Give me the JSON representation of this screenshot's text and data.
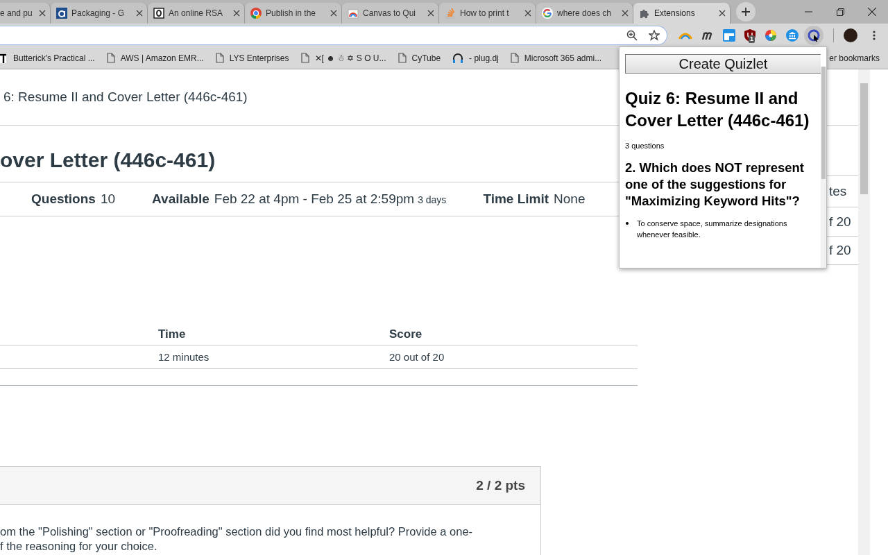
{
  "tabs": [
    {
      "title": "e and pu",
      "selected": false
    },
    {
      "title": "Packaging - G",
      "selected": false
    },
    {
      "title": "An online RSA",
      "selected": false
    },
    {
      "title": "Publish in the",
      "selected": false
    },
    {
      "title": "Canvas to Qui",
      "selected": false
    },
    {
      "title": "How to print t",
      "selected": false
    },
    {
      "title": "where does ch",
      "selected": false
    },
    {
      "title": "Extensions",
      "selected": true
    }
  ],
  "toolbar": {
    "extension_badge": "1"
  },
  "bookmarks": [
    "Butterick's Practical ...",
    "AWS | Amazon EMR...",
    "LYS Enterprises",
    "✕[ ☻ ☃ ✡ S O U...",
    "CyTube",
    "- plug.dj",
    "Microsoft 365 admi..."
  ],
  "other_bookmarks": "er bookmarks",
  "page": {
    "breadcrumb": "6: Resume II and Cover Letter (446c-461)",
    "title": "over Letter (446c-461)",
    "details": [
      {
        "label": "Questions",
        "value": "10"
      },
      {
        "label": "Available",
        "value": "Feb 22 at 4pm - Feb 25 at 2:59pm",
        "note": "3 days"
      },
      {
        "label": "Time Limit",
        "value": "None"
      }
    ],
    "sidebar": [
      "tes",
      "f 20",
      "f 20"
    ],
    "table": {
      "columns": [
        "Time",
        "Score"
      ],
      "rows": [
        [
          "12 minutes",
          "20 out of 20"
        ]
      ]
    },
    "question": {
      "points": "2 / 2 pts",
      "lines": [
        "om the \"Polishing\" section or \"Proofreading\" section did you find most helpful?  Provide a one-",
        "f the reasoning for your choice."
      ]
    }
  },
  "popup": {
    "button": "Create Quizlet",
    "title": "Quiz 6: Resume II and Cover Letter (446c-461)",
    "count": "3 questions",
    "questions": [
      {
        "text": "2. Which does NOT represent one of the suggestions for \"Maximizing Keyword Hits\"?",
        "answers": [
          "To conserve space, summarize designations whenever feasible."
        ]
      }
    ]
  }
}
